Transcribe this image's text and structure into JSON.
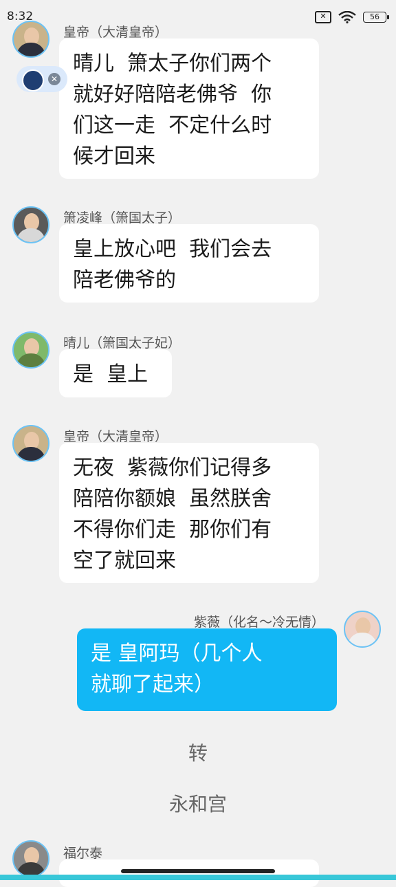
{
  "status": {
    "time": "8:32",
    "battery": "56",
    "x_icon": "close-box-icon",
    "wifi_icon": "wifi-icon"
  },
  "messages": [
    {
      "sender": "皇帝（大清皇帝）",
      "text": "晴儿  箫太子你们两个\n就好好陪陪老佛爷  你\n们这一走  不定什么时\n候才回来"
    },
    {
      "sender": "箫凌峰（箫国太子）",
      "text": "皇上放心吧  我们会去\n陪老佛爷的"
    },
    {
      "sender": "晴儿（箫国太子妃）",
      "text": "是  皇上"
    },
    {
      "sender": "皇帝（大清皇帝）",
      "text": "无夜  紫薇你们记得多\n陪陪你额娘  虽然朕舍\n不得你们走  那你们有\n空了就回来"
    },
    {
      "sender": "紫薇（化名～冷无情）",
      "text": "是 皇阿玛（几个人\n就聊了起来）"
    }
  ],
  "scene": {
    "line1": "转",
    "line2": "永和宫"
  },
  "last_sender": "福尔泰",
  "colors": {
    "mine_bubble": "#12b7f5",
    "avatar_ring": "#6cc3f5"
  }
}
